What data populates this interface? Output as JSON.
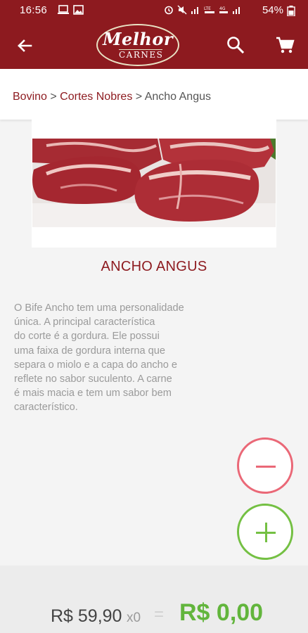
{
  "status_bar": {
    "time": "16:56",
    "battery": "54%",
    "left_icons": [
      "laptop-icon",
      "image-icon"
    ],
    "right_icons": [
      "alarm-icon",
      "mute-icon",
      "signal-icon",
      "lte-icon",
      "4g-icon",
      "signal-icon-2",
      "battery-icon"
    ]
  },
  "app_bar": {
    "logo_word1": "Melhor",
    "logo_word2": "CARNES",
    "back_icon": "arrow-left-icon",
    "search_icon": "search-icon",
    "cart_icon": "cart-icon",
    "color": "#8d1a1f"
  },
  "breadcrumb": {
    "items": [
      {
        "label": "Bovino"
      },
      {
        "label": "Cortes Nobres"
      },
      {
        "label": "Ancho Angus"
      }
    ],
    "separator": ">"
  },
  "product": {
    "name": "ANCHO ANGUS",
    "description_lines": [
      "O Bife Ancho tem uma personalidade",
      "única. A principal característica",
      "do corte é a gordura. Ele possui",
      "uma faixa de gordura interna que",
      "separa o miolo e a capa do ancho e",
      "reflete no sabor suculento. A carne",
      "é mais macia e tem um sabor bem",
      "característico."
    ]
  },
  "actions": {
    "minus_color": "#ea6877",
    "plus_color": "#74c043"
  },
  "footer": {
    "unit_price": "R$ 59,90",
    "quantity": "x0",
    "equals": "=",
    "total": "R$ 0,00",
    "total_color": "#62b53c"
  }
}
